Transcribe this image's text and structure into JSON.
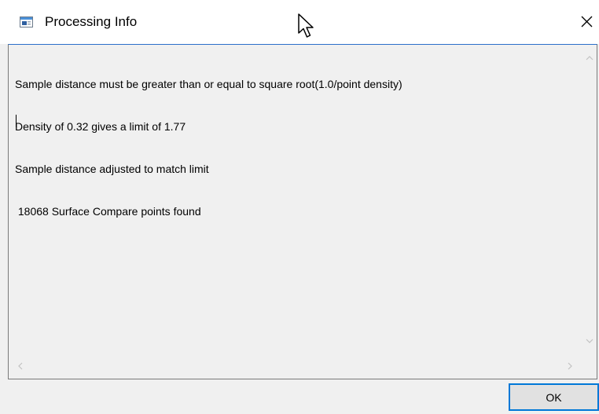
{
  "window": {
    "title": "Processing Info",
    "icon": "app-window-icon",
    "close_icon": "close-icon"
  },
  "log": {
    "lines": [
      "Sample distance must be greater than or equal to square root(1.0/point density)",
      "Density of 0.32 gives a limit of 1.77",
      "Sample distance adjusted to match limit",
      " 18068 Surface Compare points found"
    ]
  },
  "footer": {
    "ok_label": "OK"
  },
  "colors": {
    "focus_border": "#0078d7",
    "background": "#f0f0f0"
  }
}
